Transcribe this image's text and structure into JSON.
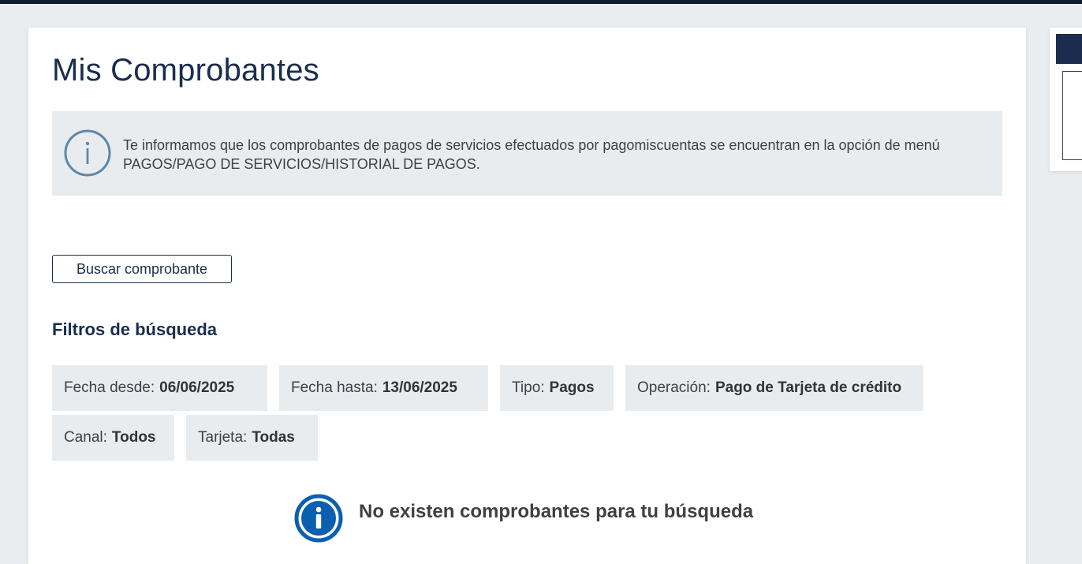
{
  "page": {
    "title": "Mis Comprobantes"
  },
  "info_banner": {
    "icon": "info-circle-outline-icon",
    "text": "Te informamos que los comprobantes de pagos de servicios efectuados por pagomiscuentas se encuentran en la opción de menú PAGOS/PAGO DE SERVICIOS/HISTORIAL DE PAGOS."
  },
  "actions": {
    "search_label": "Buscar comprobante"
  },
  "filters": {
    "title": "Filtros de búsqueda",
    "items": [
      {
        "label": "Fecha desde:",
        "value": "06/06/2025"
      },
      {
        "label": "Fecha hasta:",
        "value": "13/06/2025"
      },
      {
        "label": "Tipo:",
        "value": "Pagos"
      },
      {
        "label": "Operación:",
        "value": "Pago de Tarjeta de crédito"
      },
      {
        "label": "Canal:",
        "value": "Todos"
      },
      {
        "label": "Tarjeta:",
        "value": "Todas"
      }
    ]
  },
  "empty_state": {
    "icon": "info-circle-filled-icon",
    "message": "No existen comprobantes para tu búsqueda"
  },
  "colors": {
    "brand_navy": "#1a2d4e",
    "accent_blue": "#0b5fb0",
    "banner_bg": "#e8ecef",
    "page_bg": "#e9edf0"
  }
}
